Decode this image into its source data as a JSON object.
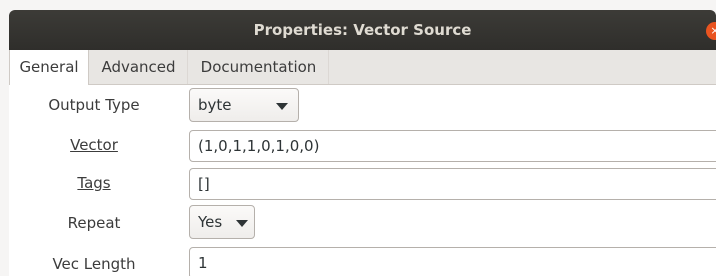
{
  "window": {
    "title": "Properties: Vector Source",
    "close_icon": "×"
  },
  "tabs": [
    {
      "label": "General",
      "active": true
    },
    {
      "label": "Advanced",
      "active": false
    },
    {
      "label": "Documentation",
      "active": false
    }
  ],
  "form": {
    "output_type": {
      "label": "Output Type",
      "value": "byte"
    },
    "vector": {
      "label": "Vector",
      "value": "(1,0,1,1,0,1,0,0)"
    },
    "tags": {
      "label": "Tags",
      "value": "[]"
    },
    "repeat": {
      "label": "Repeat",
      "value": "Yes"
    },
    "vec_length": {
      "label": "Vec Length",
      "value": "1"
    }
  },
  "colors": {
    "titlebar": "#3c3b37",
    "close_button": "#e95420"
  }
}
